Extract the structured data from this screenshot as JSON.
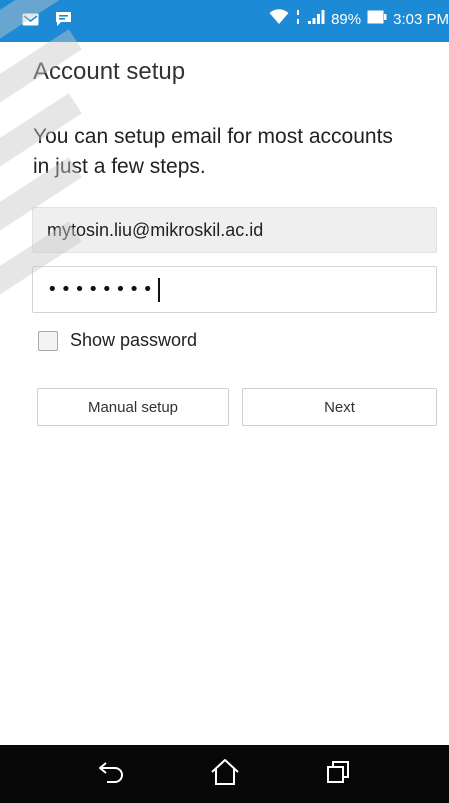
{
  "status_bar": {
    "notification_icons": [
      "email-icon",
      "chat-icon"
    ],
    "battery_percent": "89%",
    "time": "3:03 PM",
    "background_color": "#1d8ad6"
  },
  "page": {
    "title": "Account setup",
    "intro": "You can setup email for most accounts in just a few steps."
  },
  "form": {
    "email_value": "mytosin.liu@mikroskil.ac.id",
    "password_mask": "••••••••",
    "show_password_label": "Show password",
    "show_password_checked": false
  },
  "buttons": {
    "manual_setup": "Manual setup",
    "next": "Next"
  },
  "nav_bar": {
    "icons": [
      "back-icon",
      "home-icon",
      "recent-apps-icon"
    ],
    "background_color": "#070707"
  }
}
